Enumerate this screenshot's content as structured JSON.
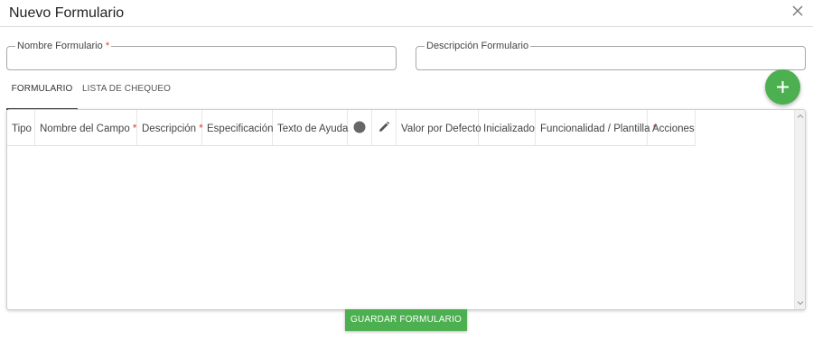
{
  "dialog": {
    "title": "Nuevo Formulario",
    "close_icon": "close-icon"
  },
  "form": {
    "nombre_label": "Nombre Formulario",
    "nombre_required": "*",
    "nombre_value": "",
    "descripcion_label": "Descripción Formulario",
    "descripcion_value": ""
  },
  "tabs": [
    {
      "label": "FORMULARIO",
      "active": true
    },
    {
      "label": "LISTA DE CHEQUEO",
      "active": false
    }
  ],
  "add_button": {
    "icon": "plus-icon",
    "color": "#4caf50"
  },
  "table": {
    "columns": [
      {
        "label": "Tipo",
        "required": ""
      },
      {
        "label": "Nombre del Campo",
        "required": "*"
      },
      {
        "label": "Descripción",
        "required": "*"
      },
      {
        "label": "Especificación",
        "required": ""
      },
      {
        "label": "Texto de Ayuda",
        "required": ""
      },
      {
        "label": "",
        "icon": "circle-icon"
      },
      {
        "label": "",
        "icon": "pencil-icon"
      },
      {
        "label": "Valor por Defecto",
        "required": ""
      },
      {
        "label": "Inicializado",
        "required": ""
      },
      {
        "label": "Funcionalidad / Plantilla",
        "required": "*"
      },
      {
        "label": "Acciones",
        "required": ""
      }
    ],
    "rows": []
  },
  "footer": {
    "save_label": "GUARDAR FORMULARIO",
    "save_color": "#4caf50"
  }
}
